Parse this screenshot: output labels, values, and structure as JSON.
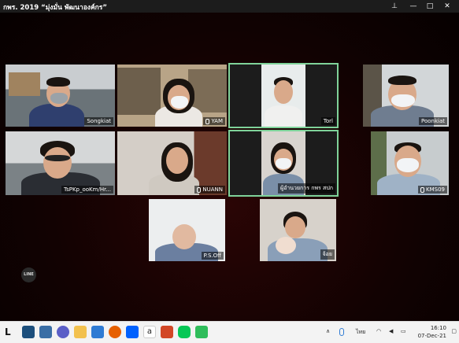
{
  "window": {
    "title": "กพร. 2019 “มุ่งมั่น พัฒนาองค์กร”"
  },
  "participants": [
    {
      "name": "Songkiat",
      "muted": false,
      "active": false
    },
    {
      "name": "YAM",
      "muted": true,
      "active": false
    },
    {
      "name": "Torl",
      "muted": false,
      "active": true
    },
    {
      "name": "Poonkiat",
      "muted": false,
      "active": false
    },
    {
      "name": "TsPKp_ooKm/Hr...",
      "muted": false,
      "active": false
    },
    {
      "name": "NUANN",
      "muted": true,
      "active": false
    },
    {
      "name": "ผู้อำนวยการ กพร สปก",
      "muted": false,
      "active": true
    },
    {
      "name": "KMS09",
      "muted": true,
      "active": false
    },
    {
      "name": "P.S.Off",
      "muted": false,
      "active": false
    },
    {
      "name": "จ้อย",
      "muted": false,
      "active": false
    }
  ],
  "overlay": {
    "line_badge": "LINE"
  },
  "taskbar": {
    "apps": [
      "Task View",
      "Camera",
      "Teams",
      "File Explorer",
      "Mail",
      "Firefox",
      "Dropbox",
      "Amazon",
      "PowerPoint",
      "LINE",
      "Phone"
    ],
    "tray": {
      "language": "ไทย"
    },
    "clock": {
      "time": "16:10",
      "date": "07-Dec-21"
    }
  }
}
